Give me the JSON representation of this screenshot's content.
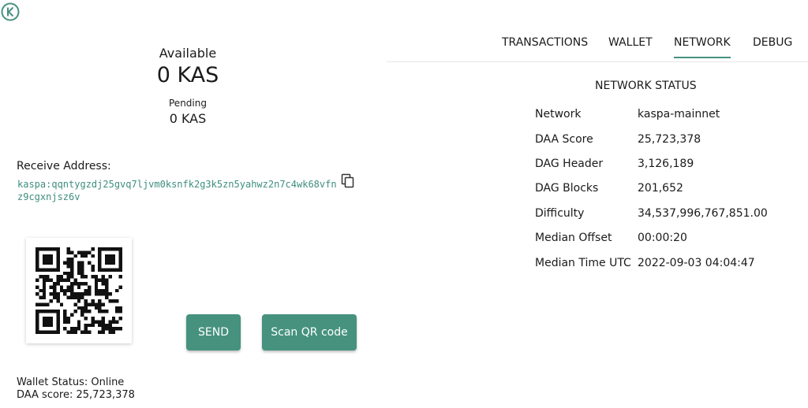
{
  "header": {
    "logo_icon": "kaspa-logo-icon"
  },
  "balance": {
    "available_label": "Available",
    "available_value": "0 KAS",
    "pending_label": "Pending",
    "pending_value": "0 KAS"
  },
  "receive": {
    "label": "Receive Address:",
    "address": "kaspa:qqntygzdj25gvq7ljvm0ksnfk2g3k5zn5yahwz2n7c4wk68vfnz9cgxnjsz6v",
    "copy_icon": "copy-icon"
  },
  "actions": {
    "send_label": "SEND",
    "scan_label": "Scan QR code"
  },
  "wallet_status": {
    "status": "Wallet Status: Online",
    "daa": "DAA score: 25,723,378"
  },
  "tabs": [
    {
      "label": "TRANSACTIONS",
      "active": false
    },
    {
      "label": "WALLET",
      "active": false
    },
    {
      "label": "NETWORK",
      "active": true
    },
    {
      "label": "DEBUG",
      "active": false
    }
  ],
  "network": {
    "title": "NETWORK STATUS",
    "rows": [
      {
        "key": "Network",
        "value": "kaspa-mainnet"
      },
      {
        "key": "DAA Score",
        "value": "25,723,378"
      },
      {
        "key": "DAG Header",
        "value": "3,126,189"
      },
      {
        "key": "DAG Blocks",
        "value": "201,652"
      },
      {
        "key": "Difficulty",
        "value": "34,537,996,767,851.00"
      },
      {
        "key": "Median Offset",
        "value": "00:00:20"
      },
      {
        "key": "Median Time UTC",
        "value": "2022-09-03 04:04:47"
      }
    ]
  },
  "colors": {
    "accent": "#46927f",
    "address": "#3e8e7e"
  }
}
